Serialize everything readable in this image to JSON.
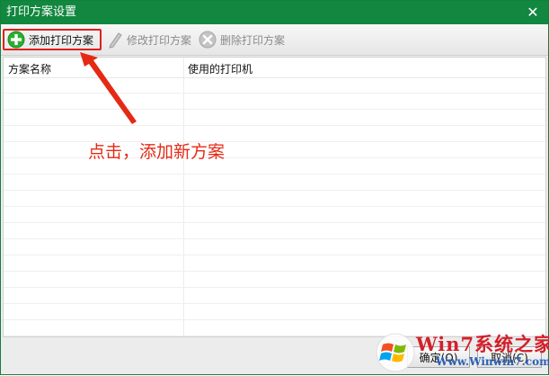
{
  "window": {
    "title": "打印方案设置"
  },
  "toolbar": {
    "add_label": "添加打印方案",
    "edit_label": "修改打印方案",
    "delete_label": "删除打印方案"
  },
  "table": {
    "columns": [
      "方案名称",
      "使用的打印机"
    ],
    "rows": []
  },
  "annotation": {
    "text": "点击，添加新方案",
    "color": "#e42a16"
  },
  "footer": {
    "ok_label": "确定(O)",
    "cancel_label": "取消(C)"
  },
  "watermark": {
    "brand": "Win7系统之家",
    "url": "Www.Winwin7.com"
  },
  "colors": {
    "titlebar": "#12873f",
    "highlight": "#e0201c"
  }
}
